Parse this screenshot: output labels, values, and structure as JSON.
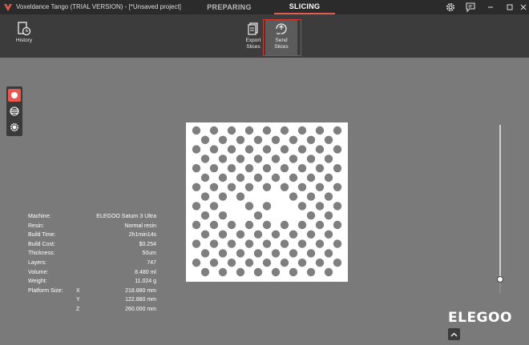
{
  "window": {
    "title": "Voxeldance Tango (TRIAL VERSION) - [*Unsaved project]",
    "tabs": [
      {
        "label": "PREPARING",
        "active": false
      },
      {
        "label": "SLICING",
        "active": true
      }
    ],
    "accent_color": "#e45b52"
  },
  "toolbar": {
    "history_label": "History",
    "export_label_line1": "Export",
    "export_label_line2": "Slices",
    "send_label_line1": "Send",
    "send_label_line2": "Slices"
  },
  "view_modes": [
    "slice-view-icon",
    "layers-view-icon",
    "gear-view-icon"
  ],
  "print_info": {
    "rows": [
      {
        "key": "Machine:",
        "value": "ELEGOO Saturn 3 Ultra"
      },
      {
        "key": "Resin:",
        "value": "Normal resin"
      },
      {
        "key": "Build Time:",
        "value": "2h1min14s"
      },
      {
        "key": "Build Cost:",
        "value": "$0.254"
      },
      {
        "key": "Thickness:",
        "value": "50um"
      },
      {
        "key": "Layers:",
        "value": "747"
      },
      {
        "key": "Volume:",
        "value": "8.480 ml"
      },
      {
        "key": "Weight:",
        "value": "11.024 g"
      }
    ],
    "platform_label": "Platform Size:",
    "platform": [
      {
        "axis": "X",
        "value": "218.880 mm"
      },
      {
        "axis": "Y",
        "value": "122.880 mm"
      },
      {
        "axis": "Z",
        "value": "260.000 mm"
      }
    ]
  },
  "slider": {
    "layer_fraction": 0.0
  },
  "brand": {
    "logo": "ELEGOO"
  }
}
